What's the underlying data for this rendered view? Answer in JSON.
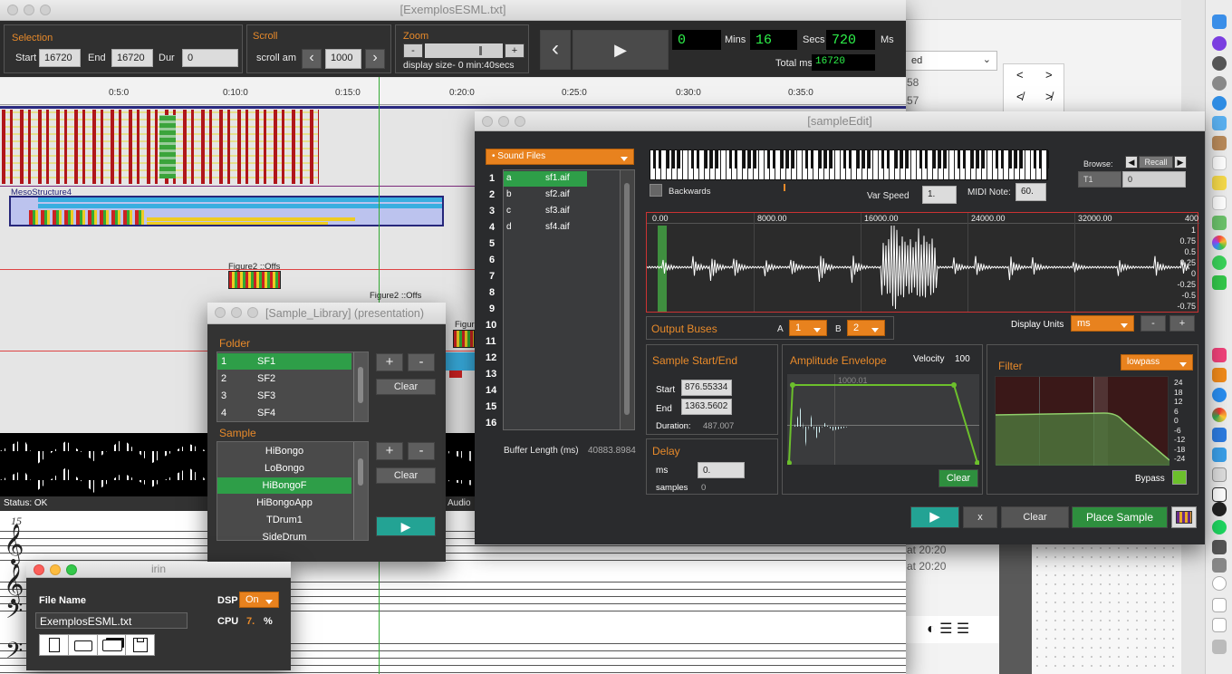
{
  "esml": {
    "title": "[ExemplosESML.txt]",
    "selection": {
      "heading": "Selection",
      "start_label": "Start",
      "start": "16720",
      "end_label": "End",
      "end": "16720",
      "dur_label": "Dur",
      "dur": "0"
    },
    "scroll": {
      "heading": "Scroll",
      "label": "scroll am",
      "value": "1000",
      "prev": "‹",
      "next": "›"
    },
    "zoom": {
      "heading": "Zoom",
      "minus": "-",
      "plus": "+",
      "display": "display size- 0 min:40secs"
    },
    "transport": {
      "back": "‹",
      "play": "▶",
      "counter": "0",
      "mins_label": "Mins",
      "mins": "16",
      "secs_label": "Secs",
      "secs": "720",
      "ms_label": "Ms",
      "total_label": "Total ms",
      "total": "16720"
    },
    "ruler": [
      "0:5:0",
      "0:10:0",
      "0:15:0",
      "0:20:0",
      "0:25:0",
      "0:30:0",
      "0:35:0"
    ],
    "meso_label": "MesoStructure4",
    "fig1": "Figure2 ::Offs",
    "fig2": "Figure2 ::Offs",
    "fig3": "Figur",
    "status": "Status: OK",
    "audio": "Audio",
    "staff_num": "15"
  },
  "bg": {
    "dropdown": "ed",
    "num1": "58",
    "num2": "57",
    "time1": "at 20:20",
    "time2": "at 20:20"
  },
  "library": {
    "title": "[Sample_Library] (presentation)",
    "folder_heading": "Folder",
    "folders": [
      {
        "num": "1",
        "name": "SF1"
      },
      {
        "num": "2",
        "name": "SF2"
      },
      {
        "num": "3",
        "name": "SF3"
      },
      {
        "num": "4",
        "name": "SF4"
      }
    ],
    "plus": "+",
    "minus": "-",
    "clear": "Clear",
    "sample_heading": "Sample",
    "samples": [
      "HiBongo",
      "LoBongo",
      "HiBongoF",
      "HiBongoApp",
      "TDrum1",
      "SideDrum"
    ],
    "play": "▶"
  },
  "irin": {
    "title": "irin",
    "file_label": "File Name",
    "file": "ExemplosESML.txt",
    "dsp_label": "DSP",
    "dsp": "On",
    "cpu_label": "CPU",
    "cpu": "7.",
    "cpu_unit": "%"
  },
  "sampleEdit": {
    "title": "[sampleEdit]",
    "sound_files": "• Sound Files",
    "slots": [
      "1",
      "2",
      "3",
      "4",
      "5",
      "6",
      "7",
      "8",
      "9",
      "10",
      "11",
      "12",
      "13",
      "14",
      "15",
      "16"
    ],
    "files": [
      {
        "key": "a",
        "name": "sf1.aif"
      },
      {
        "key": "b",
        "name": "sf2.aif"
      },
      {
        "key": "c",
        "name": "sf3.aif"
      },
      {
        "key": "d",
        "name": "sf4.aif"
      }
    ],
    "buffer_label": "Buffer Length (ms)",
    "buffer": "40883.8984",
    "backwards": "Backwards",
    "var_speed_label": "Var Speed",
    "var_speed": "1.",
    "midi_label": "MIDI Note:",
    "midi": "60.",
    "browse": "Browse:",
    "recall": "Recall",
    "t1": "T1",
    "t1_val": "0",
    "wave_ticks": [
      "0.00",
      "8000.00",
      "16000.00",
      "24000.00",
      "32000.00",
      "400"
    ],
    "amp_ticks": [
      "1",
      "0.75",
      "0.5",
      "0.25",
      "0",
      "-0.25",
      "-0.5",
      "-0.75"
    ],
    "output_buses": "Output Buses",
    "bus_a_label": "A",
    "bus_a": "1",
    "bus_b_label": "B",
    "bus_b": "2",
    "display_units_label": "Display Units",
    "display_units": "ms",
    "minus": "-",
    "plus": "+",
    "ss_heading": "Sample Start/End",
    "start_label": "Start",
    "start": "876.55334",
    "end_label": "End",
    "end": "1363.5602",
    "duration_label": "Duration:",
    "duration": "487.007",
    "delay_heading": "Delay",
    "ms_label": "ms",
    "ms": "0.",
    "samples_label": "samples",
    "samples": "0",
    "amp_heading": "Amplitude Envelope",
    "velocity_label": "Velocity",
    "velocity": "100",
    "env_tick": "1000.01",
    "clear": "Clear",
    "filter_heading": "Filter",
    "filter_type": "lowpass",
    "filter_ticks": [
      "24",
      "18",
      "12",
      "6",
      "0",
      "-6",
      "-12",
      "-18",
      "-24"
    ],
    "bypass": "Bypass",
    "play": "▶",
    "x": "x",
    "clear_btn": "Clear",
    "place": "Place Sample"
  }
}
